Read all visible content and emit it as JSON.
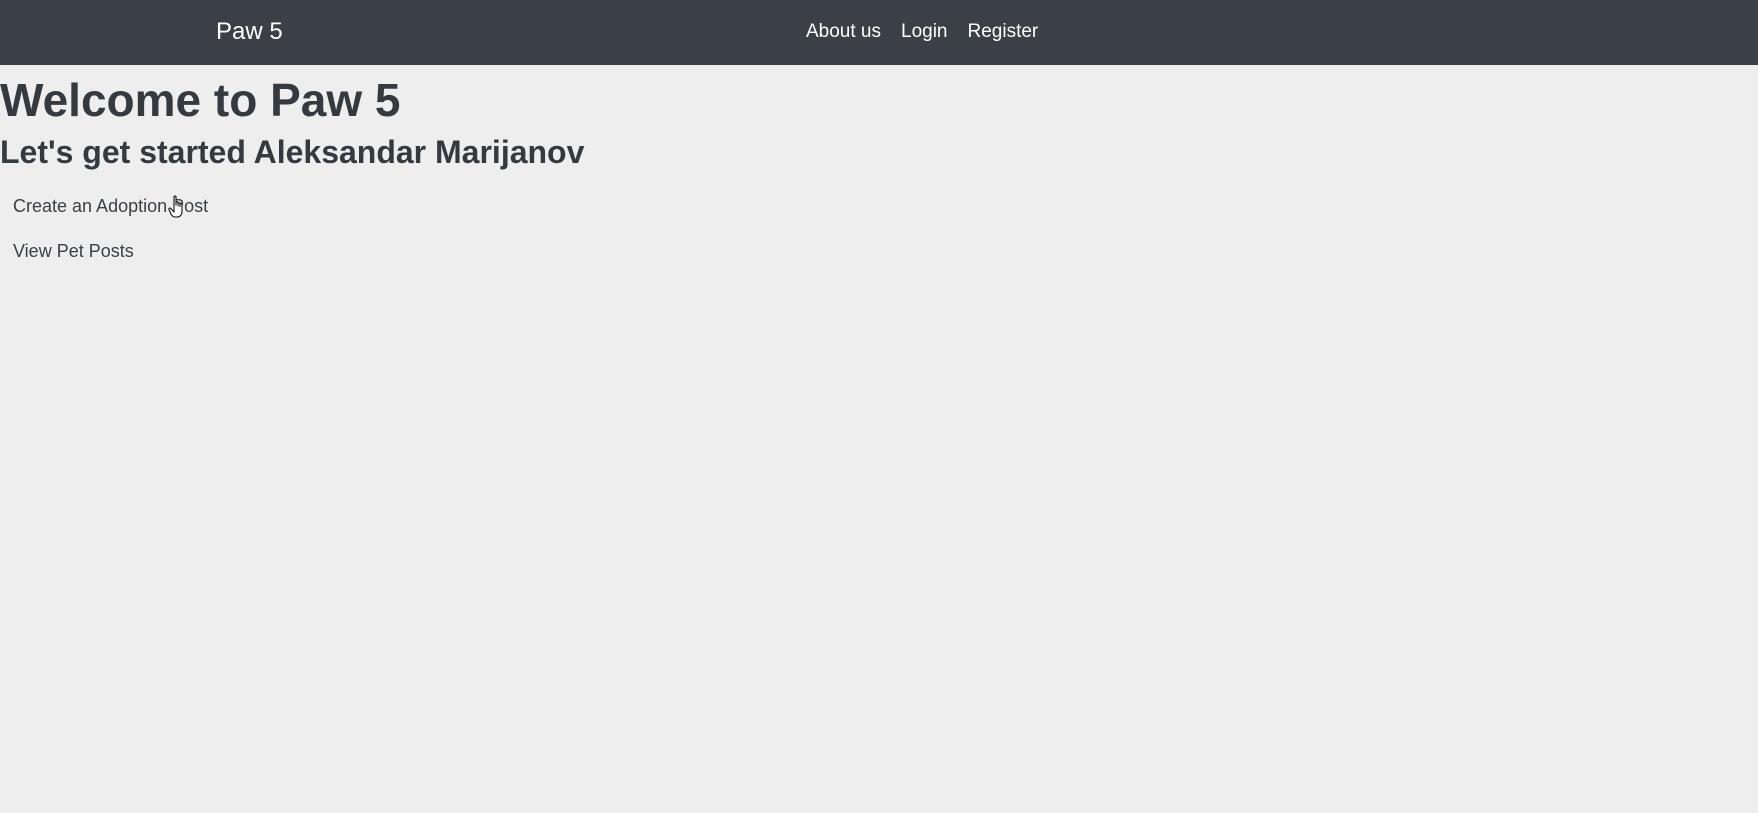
{
  "navbar": {
    "brand": "Paw 5",
    "links": [
      "About us",
      "Login",
      "Register"
    ]
  },
  "main": {
    "title": "Welcome to Paw 5",
    "subtitle": "Let's get started Aleksandar Marijanov",
    "actions": [
      "Create an Adoption Post",
      "View Pet Posts"
    ]
  },
  "cursor": "hand-pointer-icon"
}
